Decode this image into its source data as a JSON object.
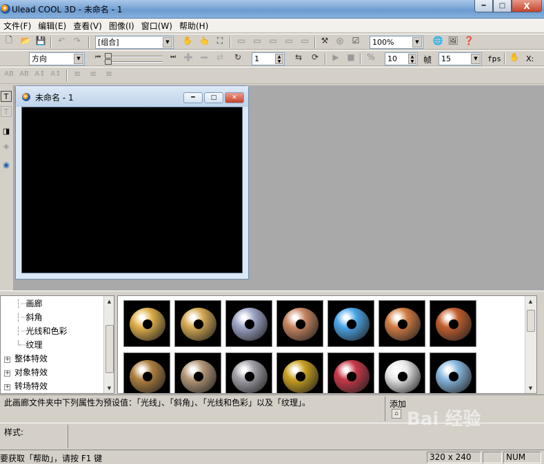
{
  "window": {
    "title": "Ulead COOL 3D - 未命名 - 1",
    "minimize": "0",
    "maximize": "□",
    "close": "X"
  },
  "menu": [
    "文件(F)",
    "编辑(E)",
    "查看(V)",
    "图像(I)",
    "窗口(W)",
    "帮助(H)"
  ],
  "toolbar1": {
    "object_combo": "[组合]",
    "zoom_combo": "100%"
  },
  "toolbar2": {
    "direction_combo": "方向",
    "frame_value": "1",
    "frames_value": "10",
    "frames_unit": "帧",
    "fps_value": "15",
    "fps_unit": "fps",
    "x_label": "X:"
  },
  "toolbar3": {
    "buttons": [
      "AB",
      "AB",
      "A↕",
      "A↕",
      "≡",
      "≡",
      "≡"
    ]
  },
  "child_window": {
    "title": "未命名 - 1"
  },
  "tree": {
    "items": [
      {
        "label": "画廊",
        "expander": ""
      },
      {
        "label": "斜角",
        "expander": ""
      },
      {
        "label": "光线和色彩",
        "expander": ""
      },
      {
        "label": "纹理",
        "expander": ""
      },
      {
        "label": "整体特效",
        "expander": "+"
      },
      {
        "label": "对象特效",
        "expander": "+"
      },
      {
        "label": "转场特效",
        "expander": "+"
      }
    ]
  },
  "gallery": {
    "thumbnails": [
      {
        "name": "gold-ring",
        "color": "#e0b048"
      },
      {
        "name": "gold-ring-shiny",
        "color": "#d6aa52"
      },
      {
        "name": "silver-ring",
        "color": "#9ea6c8"
      },
      {
        "name": "copper-ring",
        "color": "#c88660"
      },
      {
        "name": "blue-ring",
        "color": "#4aa6e8"
      },
      {
        "name": "wood-ring",
        "color": "#d27c42"
      },
      {
        "name": "rust-ring",
        "color": "#c25e2c"
      },
      {
        "name": "bronze-ring",
        "color": "#b08040"
      },
      {
        "name": "stone-ring",
        "color": "#b49878"
      },
      {
        "name": "chain-ring",
        "color": "#a0a0a8"
      },
      {
        "name": "speckled-ring",
        "color": "#c8a020"
      },
      {
        "name": "stained-ring",
        "color": "#c83848"
      },
      {
        "name": "white-ring",
        "color": "#e8e8e8"
      },
      {
        "name": "glass-ring",
        "color": "#88b8e0"
      }
    ]
  },
  "description": {
    "text": "此画廊文件夹中下列属性为预设值：「光线」、「斜角」、「光线和色彩」以及「纹理」。",
    "add_label": "添加"
  },
  "styles": {
    "label": "样式:"
  },
  "statusbar": {
    "help_text": "要获取「帮助」，请按 F1 键",
    "size": "320 x 240",
    "num": "NUM"
  },
  "watermark": {
    "text": "Bai 经验"
  }
}
